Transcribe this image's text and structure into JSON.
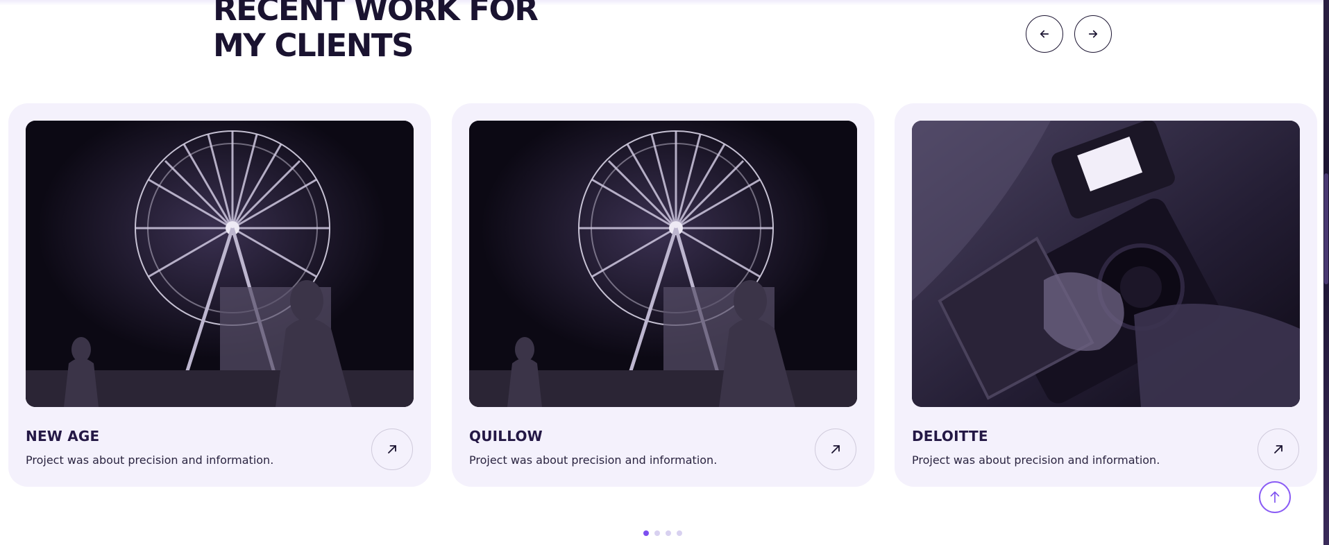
{
  "section": {
    "heading_line1": "RECENT WORK FOR",
    "heading_line2": "MY CLIENTS"
  },
  "carousel": {
    "prev_icon": "arrow-left-icon",
    "next_icon": "arrow-right-icon",
    "slide_count": 4,
    "active_slide": 1
  },
  "cards": [
    {
      "title": "NEW AGE",
      "description": "Project was about precision and information.",
      "image": "ferris-wheel-night-photo",
      "link_icon": "arrow-up-right-icon"
    },
    {
      "title": "QUILLOW",
      "description": "Project was about precision and information.",
      "image": "ferris-wheel-night-photo",
      "link_icon": "arrow-up-right-icon"
    },
    {
      "title": "DELOITTE",
      "description": "Project was about precision and information.",
      "image": "video-camera-hands-photo",
      "link_icon": "arrow-up-right-icon"
    }
  ],
  "scroll_top": {
    "icon": "arrow-up-icon"
  },
  "colors": {
    "heading": "#1a1330",
    "card_bg": "#f4f1fc",
    "accent": "#7c4ff0",
    "card_title": "#241845"
  }
}
